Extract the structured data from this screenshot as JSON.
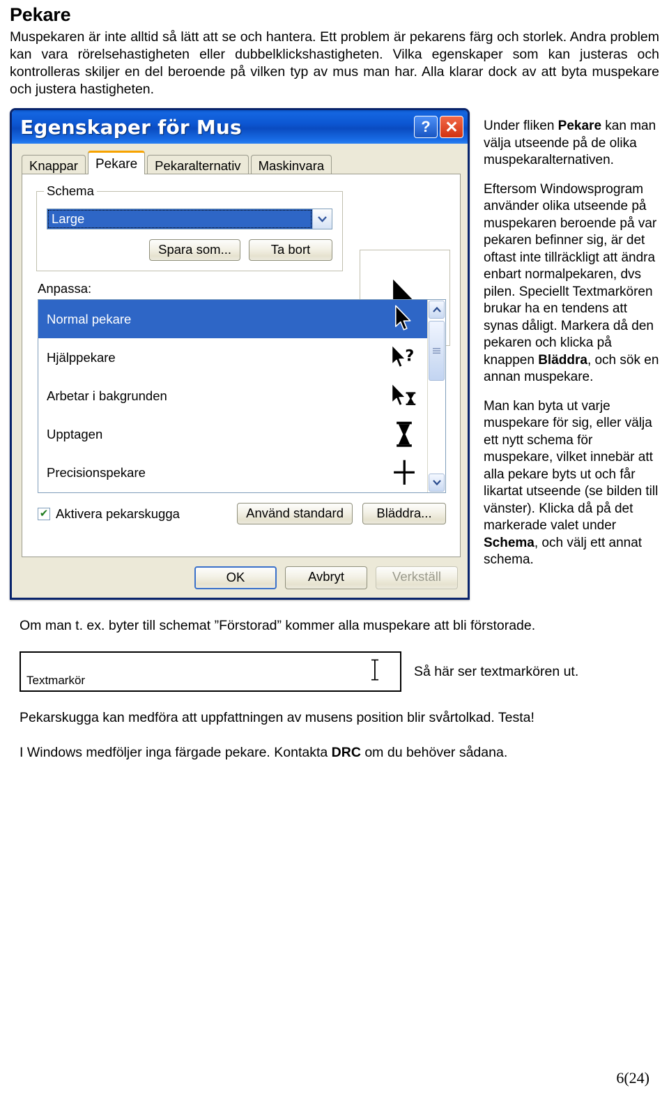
{
  "heading": "Pekare",
  "intro": "Muspekaren är inte alltid så lätt att se och hantera. Ett problem är pekarens färg och storlek. Andra problem kan vara rörelsehastigheten eller dubbelklickshastigheten. Vilka egenskaper som kan justeras och kontrolleras skiljer en del beroende på vilken typ av mus man har. Alla klarar dock av att byta muspekare och justera hastigheten.",
  "dialog": {
    "title": "Egenskaper för Mus",
    "help_button": "?",
    "close_button": "✕",
    "tabs": [
      {
        "label": "Knappar",
        "active": false
      },
      {
        "label": "Pekare",
        "active": true
      },
      {
        "label": "Pekaralternativ",
        "active": false
      },
      {
        "label": "Maskinvara",
        "active": false
      }
    ],
    "schema": {
      "legend": "Schema",
      "selected_value": "Large",
      "dropdown_arrow": "⌄",
      "save_as_button": "Spara som...",
      "delete_button": "Ta bort"
    },
    "customize": {
      "label": "Anpassa:",
      "items": [
        {
          "name": "Normal pekare",
          "cursor": "arrow-cursor",
          "selected": true
        },
        {
          "name": "Hjälppekare",
          "cursor": "arrow-help-cursor",
          "selected": false
        },
        {
          "name": "Arbetar i bakgrunden",
          "cursor": "arrow-busy-cursor",
          "selected": false
        },
        {
          "name": "Upptagen",
          "cursor": "hourglass-cursor",
          "selected": false
        },
        {
          "name": "Precisionspekare",
          "cursor": "crosshair-cursor",
          "selected": false
        }
      ],
      "scroll_up": "⌃",
      "scroll_down": "⌄"
    },
    "shadow_checkbox": {
      "label": "Aktivera pekarskugga",
      "checked": true,
      "check_glyph": "✔"
    },
    "use_default_button": "Använd standard",
    "browse_button": "Bläddra...",
    "ok_button": "OK",
    "cancel_button": "Avbryt",
    "apply_button": "Verkställ"
  },
  "sidebar": {
    "p1_a": "Under fliken ",
    "p1_b": "Pekare",
    "p1_c": " kan man välja utseende på de olika muspekaralternativen.",
    "p2_a": "Eftersom Windowsprogram använder olika utseende på muspekaren beroende på var pekaren befinner sig, är det oftast inte tillräckligt att ändra enbart normalpekaren, dvs pilen. Speciellt Textmarkören brukar ha en tendens att synas dåligt. Markera då den pekaren och klicka på knappen ",
    "p2_b": "Bläddra",
    "p2_c": ", och sök en annan muspekare.",
    "p3_a": "Man kan byta ut varje muspekare för sig, eller välja ett nytt schema för muspekare, vilket innebär att alla pekare byts ut och får likartat utseende (se bilden till vänster). Klicka då på det markerade valet under ",
    "p3_b": "Schema",
    "p3_c": ", och välj ett annat schema."
  },
  "lower": {
    "note1": "Om man t. ex. byter till schemat ”Förstorad” kommer alla muspekare att bli förstorade.",
    "textbox_label": "Textmarkör",
    "textbox_cursor": "ibeam-cursor",
    "demo_caption": "Så här ser textmarkören ut.",
    "note2": "Pekarskugga kan medföra att uppfattningen av musens position blir svårtolkad. Testa!",
    "note3_a": "I Windows medföljer inga färgade pekare. Kontakta ",
    "note3_b": "DRC",
    "note3_c": " om du behöver sådana."
  },
  "page_number": "6(24)",
  "colors": {
    "titlebar_blue": "#0d56c8",
    "dialog_border": "#0A246A",
    "dialog_face": "#ECE9D8",
    "selection_blue": "#2f66c4",
    "active_tab_accent": "#F5A300",
    "close_red": "#cf3310"
  }
}
